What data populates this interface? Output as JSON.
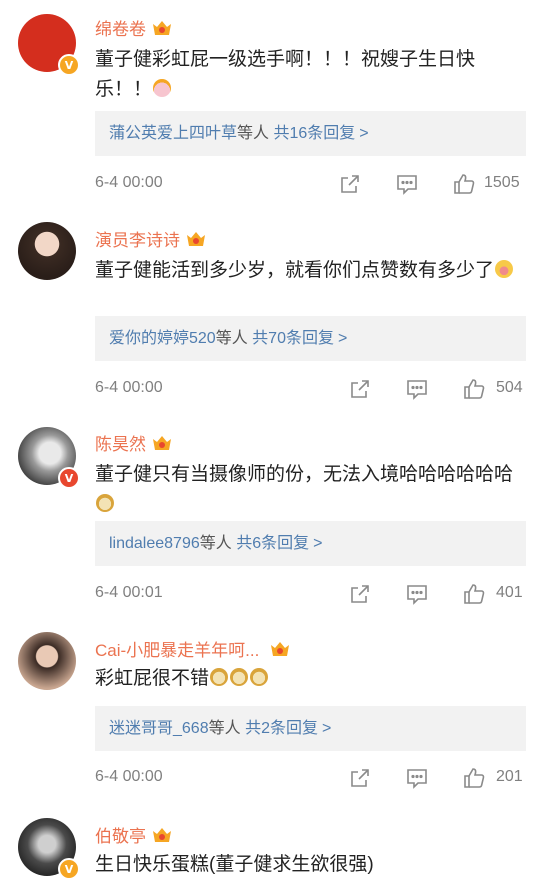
{
  "colors": {
    "username": "#eb7350",
    "link": "#507daf",
    "meta": "#808080",
    "reply_bg": "#f2f2f2",
    "vip_gold": "#f6a623",
    "verified_red": "#e8472f"
  },
  "comments": [
    {
      "username": "绵卷卷",
      "text": "董子健彩虹屁一级选手啊！！！祝嫂子生日快乐！！",
      "emoji": "cake",
      "reply_names": "蒲公英爱上四叶草",
      "reply_who": "等人",
      "reply_count": "共16条回复",
      "time": "6-4 00:00",
      "likes": "1505"
    },
    {
      "username": "演员李诗诗",
      "text": "董子健能活到多少岁，就看你们点赞数有多少了",
      "emoji": "face",
      "reply_names": "爱你的婷婷520",
      "reply_who": "等人",
      "reply_count": "共70条回复",
      "time": "6-4 00:00",
      "likes": "504"
    },
    {
      "username": "陈昊然",
      "text": "董子健只有当摄像师的份，无法入境哈哈哈哈哈哈",
      "emoji": "doge",
      "reply_names": "lindalee8796",
      "reply_who": "等人",
      "reply_count": "共6条回复",
      "time": "6-4 00:01",
      "likes": "401"
    },
    {
      "username": "Cai-小肥暴走羊年呵...",
      "text": "彩虹屁很不错",
      "emoji": "doge-x3",
      "reply_names": "迷迷哥哥_668",
      "reply_who": "等人",
      "reply_count": "共2条回复",
      "time": "6-4 00:00",
      "likes": "201"
    },
    {
      "username": "伯敬亭",
      "text": "生日快乐蛋糕(董子健求生欲很强)"
    }
  ],
  "chevron": ">",
  "icons": [
    "share-icon",
    "comment-icon",
    "like-icon",
    "vip-crown-icon",
    "verified-badge-icon"
  ]
}
